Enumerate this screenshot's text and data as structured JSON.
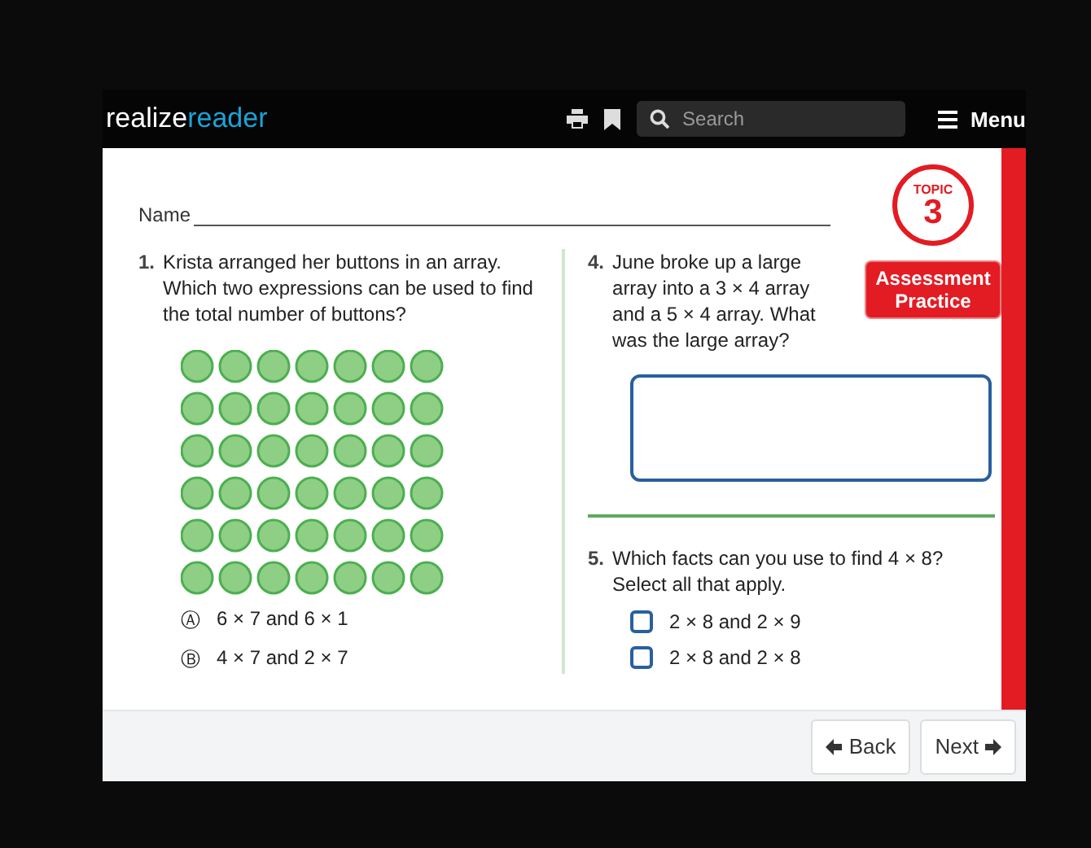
{
  "header": {
    "logo_first": "realize",
    "logo_second": "reader",
    "search": {
      "placeholder": "Search"
    },
    "menu": "Menu"
  },
  "badge": {
    "topic_label": "TOPIC",
    "topic_number": "3",
    "title": "Assessment Practice"
  },
  "name_label": "Name",
  "left_question": {
    "number": "1.",
    "text": "Krista arranged her buttons in an array. Which two expressions can be used to find the total number of buttons?",
    "options": [
      {
        "letter": "Ⓐ",
        "text": "6 × 7 and 6 × 1"
      },
      {
        "letter": "Ⓑ",
        "text": "4 × 7 and 2 × 7"
      }
    ]
  },
  "right_questions": [
    {
      "kind": "open",
      "number": "4.",
      "text": "June broke up a large array into a 3 × 4 array and a 5 × 4 array. What was the large array?"
    },
    {
      "kind": "multi",
      "number": "5.",
      "text": "Which facts can you use to find 4 × 8? Select all that apply.",
      "choices": [
        {
          "text": "2 × 8 and 2 × 9",
          "checked": false
        },
        {
          "text": "2 × 8 and 2 × 8",
          "checked": false
        }
      ]
    }
  ],
  "footer": {
    "buttons": [
      {
        "label": "Back",
        "kind": "back"
      },
      {
        "label": "Next",
        "kind": "next"
      }
    ]
  }
}
